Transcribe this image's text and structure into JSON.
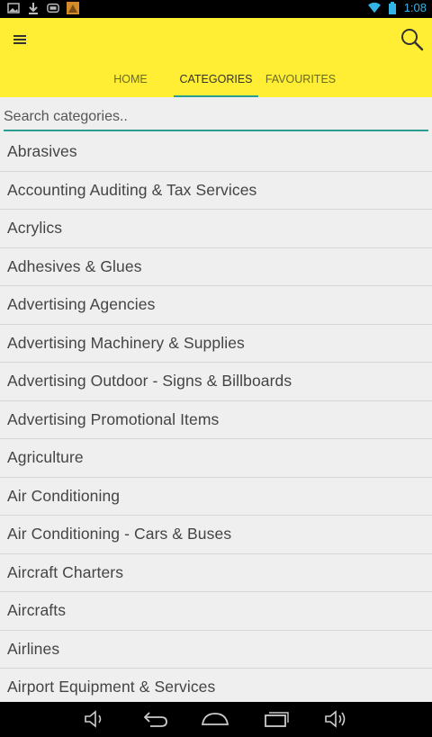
{
  "status_bar": {
    "time": "1:08",
    "left_icons": [
      "image-icon",
      "download-icon",
      "app-icon",
      "game-icon"
    ],
    "right_icons": [
      "wifi-icon",
      "battery-icon"
    ]
  },
  "colors": {
    "header_bg": "#ffee33",
    "accent": "#2a9d8f",
    "list_bg": "#efefef"
  },
  "tabs": [
    {
      "label": "HOME",
      "active": false
    },
    {
      "label": "CATEGORIES",
      "active": true
    },
    {
      "label": "FAVOURITES",
      "active": false
    }
  ],
  "search": {
    "placeholder": "Search categories..",
    "value": ""
  },
  "categories": [
    "Abrasives",
    "Accounting Auditing & Tax Services",
    "Acrylics",
    "Adhesives & Glues",
    "Advertising Agencies",
    "Advertising Machinery & Supplies",
    "Advertising Outdoor - Signs & Billboards",
    "Advertising Promotional Items",
    "Agriculture",
    "Air Conditioning",
    "Air Conditioning - Cars & Buses",
    "Aircraft Charters",
    "Aircrafts",
    "Airlines",
    "Airport Equipment & Services"
  ],
  "nav_buttons": [
    "volume-down-icon",
    "back-icon",
    "home-icon",
    "recents-icon",
    "volume-up-icon"
  ]
}
